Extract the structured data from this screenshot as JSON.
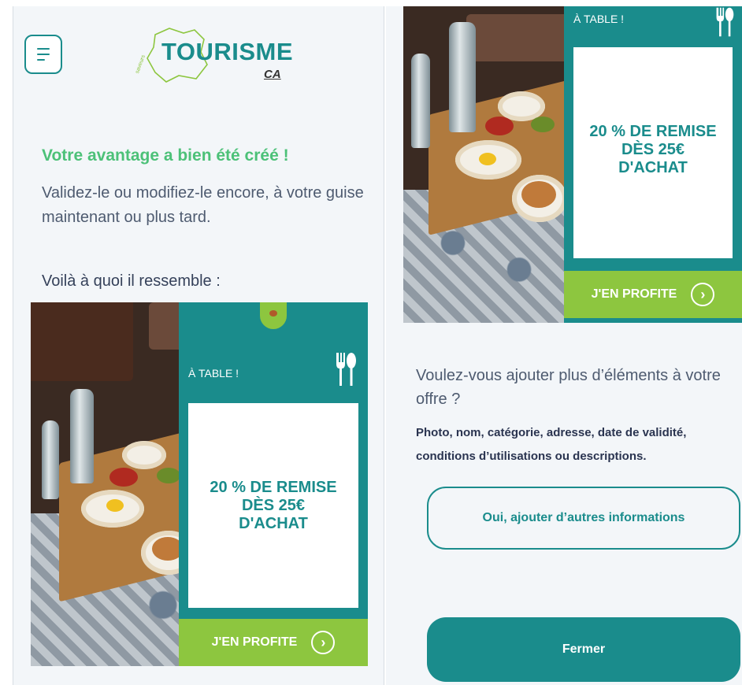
{
  "header": {
    "logo_text": "TOURISME",
    "logo_sub": "by",
    "logo_brand": "CA"
  },
  "left": {
    "success_title": "Votre avantage a bien été créé !",
    "success_text": "Validez-le ou modifiez-le encore, à votre guise maintenant ou plus tard.",
    "preview_label": "Voilà à quoi il ressemble :"
  },
  "card": {
    "category": "À TABLE !",
    "category_icon": "fork-spoon-icon",
    "offer": "20 % DE REMISE DÈS 25€ D'ACHAT",
    "cta": "J'EN PROFITE",
    "cta_icon": "chevron-right-circle-icon"
  },
  "right": {
    "question": "Voulez-vous ajouter plus d’éléments à votre offre ?",
    "question_detail": "Photo, nom, catégorie, adresse, date de validité, conditions d’utilisations ou descriptions.",
    "add_info_button": "Oui, ajouter d’autres informations",
    "close_button": "Fermer"
  },
  "colors": {
    "teal": "#1a8c8c",
    "green": "#8dc63f",
    "success": "#4cc178"
  }
}
